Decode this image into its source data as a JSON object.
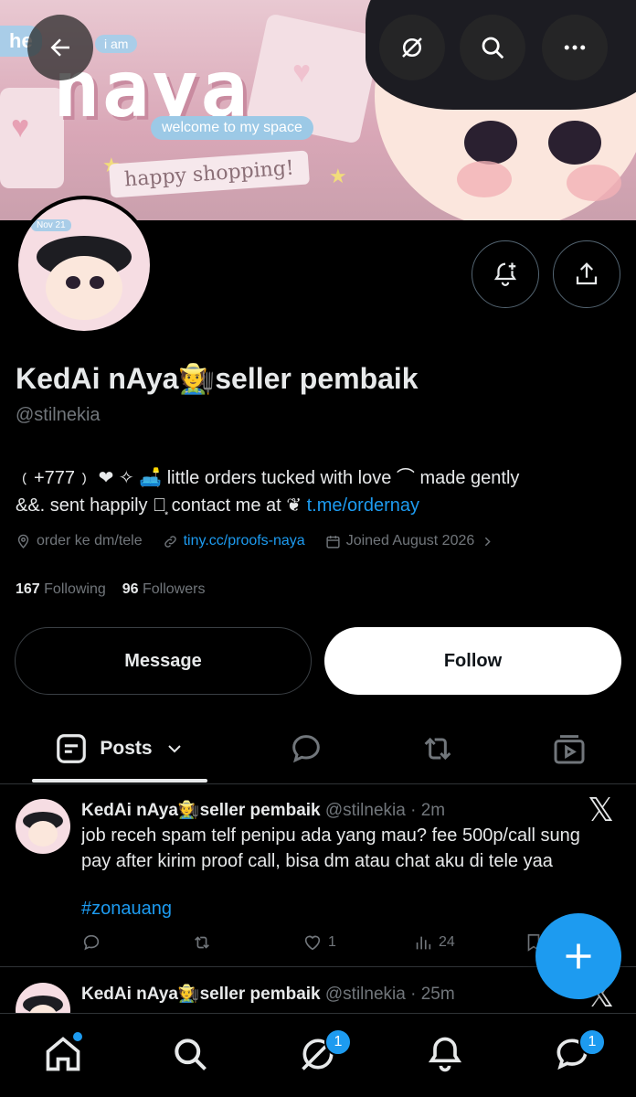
{
  "banner": {
    "top_text": "he",
    "iam_text": "i am",
    "title": "naya",
    "welcome": "welcome to my space",
    "ribbon": "happy shopping!"
  },
  "header_buttons": {
    "back": "back-arrow-icon",
    "grok": "grok-icon",
    "search": "search-icon",
    "more": "more-icon"
  },
  "profile": {
    "avatar_badge": "Nov 21",
    "name": "KedAi nAya🧑‍🌾seller pembaik",
    "handle": "@stilnekia",
    "bio_line1": "﹙+777﹚ ❤ ✧  🛋️  little orders tucked with love  ⌒  made gently",
    "bio_line2": "&&.   sent happily  ‧͙  contact me at ❦",
    "bio_link": "t.me/ordernay",
    "location": "order ke dm/tele",
    "website": "tiny.cc/proofs-naya",
    "joined": "Joined August 2026",
    "following_count": "167",
    "following_label": "Following",
    "followers_count": "96",
    "followers_label": "Followers"
  },
  "actions": {
    "message": "Message",
    "follow": "Follow"
  },
  "tabs": {
    "posts": "Posts"
  },
  "tweets": [
    {
      "name": "KedAi nAya🧑‍🌾seller pembaik",
      "handle": "@stilnekia",
      "time": "· 2m",
      "line1": "job receh spam telf penipu ada yang mau? fee 500p/call sung",
      "line2": "pay after kirim proof call, bisa dm atau chat aku di tele yaa",
      "hashtag": "#zonauang",
      "likes": "1",
      "views": "24"
    },
    {
      "name": "KedAi nAya🧑‍🌾seller pembaik",
      "handle": "@stilnekia",
      "time": "· 25m"
    }
  ],
  "nav": {
    "grok_badge": "1",
    "messages_badge": "1"
  },
  "colors": {
    "accent": "#1d9bf0",
    "background": "#000000",
    "text": "#e7e9ea",
    "muted": "#71767b"
  }
}
